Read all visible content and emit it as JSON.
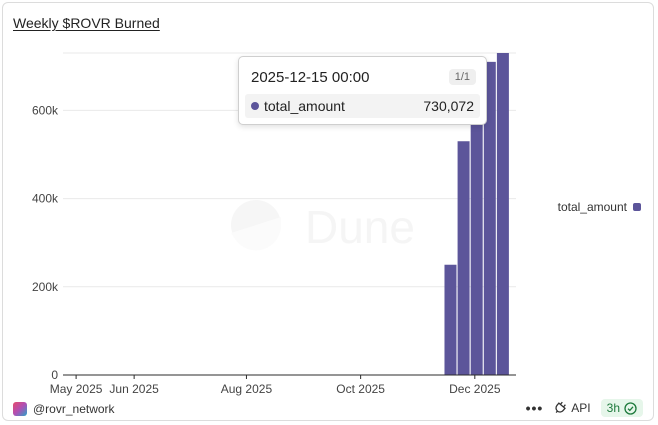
{
  "title": "Weekly $ROVR Burned",
  "watermark": "Dune",
  "tooltip": {
    "date": "2025-12-15 00:00",
    "page": "1/1",
    "series": "total_amount",
    "value": "730,072"
  },
  "legend": {
    "label": "total_amount"
  },
  "footer": {
    "handle": "@rovr_network",
    "more": "•••",
    "api": "API",
    "refresh": "3h"
  },
  "colors": {
    "bar": "#5c559a",
    "grid": "#e9e9e9",
    "axis": "#2b2b2b"
  },
  "chart_data": {
    "type": "bar",
    "title": "Weekly $ROVR Burned",
    "series": [
      {
        "name": "total_amount",
        "x": [
          "2025-11-17",
          "2025-11-24",
          "2025-12-01",
          "2025-12-08",
          "2025-12-15"
        ],
        "values": [
          250000,
          530000,
          665000,
          710000,
          730072
        ]
      }
    ],
    "x_range": [
      "2025-04-24",
      "2025-12-22"
    ],
    "x_ticks": [
      {
        "date": "2025-05-01",
        "label": "May 2025"
      },
      {
        "date": "2025-06-01",
        "label": "Jun 2025"
      },
      {
        "date": "2025-07-31",
        "label": "Aug 2025"
      },
      {
        "date": "2025-09-30",
        "label": "Oct 2025"
      },
      {
        "date": "2025-11-30",
        "label": "Dec 2025"
      }
    ],
    "ylim": [
      0,
      730072
    ],
    "y_ticks": [
      {
        "value": 0,
        "label": "0"
      },
      {
        "value": 200000,
        "label": "200k"
      },
      {
        "value": 400000,
        "label": "400k"
      },
      {
        "value": 600000,
        "label": "600k"
      }
    ],
    "grid": true,
    "legend_position": "right"
  }
}
